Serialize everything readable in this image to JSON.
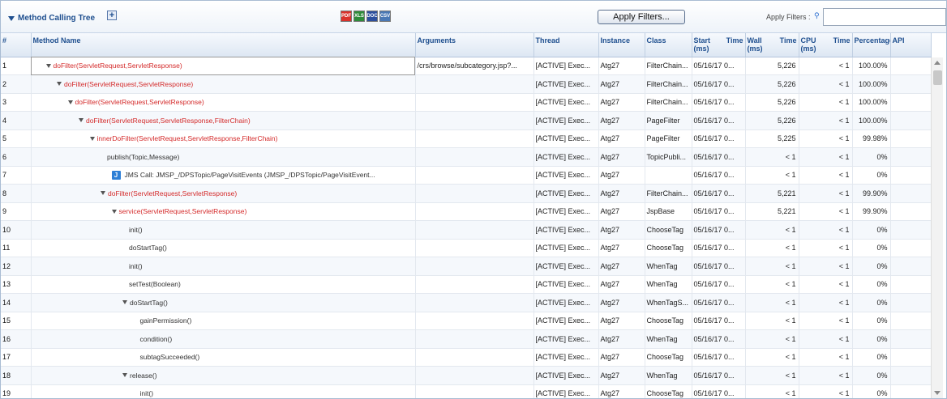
{
  "toolbar": {
    "title": "Method Calling Tree",
    "expand_label": "+",
    "exports": [
      {
        "label": "PDF",
        "icon": "pdf-icon"
      },
      {
        "label": "XLS",
        "icon": "excel-icon"
      },
      {
        "label": "DOC",
        "icon": "word-icon"
      },
      {
        "label": "CSV",
        "icon": "csv-icon"
      }
    ],
    "apply_filters_button": "Apply Filters...",
    "apply_filters_label": "Apply Filters :",
    "search_icon": "search-icon",
    "filter_value": "",
    "filter_placeholder": ""
  },
  "columns": {
    "idx": "#",
    "method": "Method Name",
    "arguments": "Arguments",
    "thread": "Thread",
    "instance": "Instance",
    "class": "Class",
    "start_a": "Start",
    "start_b": "Time",
    "start_unit": "(ms)",
    "wall_a": "Wall",
    "wall_b": "Time",
    "wall_unit": "(ms)",
    "cpu_a": "CPU",
    "cpu_b": "Time",
    "cpu_unit": "(ms)",
    "percentage": "Percentage",
    "api": "API"
  },
  "rows": [
    {
      "idx": "1",
      "depth": 0,
      "expand": true,
      "color": "red",
      "method": "doFilter(ServletRequest,ServletResponse)",
      "arguments": "/crs/browse/subcategory.jsp?...",
      "thread": "[ACTIVE] Exec...",
      "instance": "Atg27",
      "class": "FilterChain...",
      "start": "05/16/17 0...",
      "wall": "5,226",
      "cpu": "< 1",
      "pct": "100.00%",
      "api": ""
    },
    {
      "idx": "2",
      "depth": 1,
      "expand": true,
      "color": "red",
      "method": "doFilter(ServletRequest,ServletResponse)",
      "arguments": "",
      "thread": "[ACTIVE] Exec...",
      "instance": "Atg27",
      "class": "FilterChain...",
      "start": "05/16/17 0...",
      "wall": "5,226",
      "cpu": "< 1",
      "pct": "100.00%",
      "api": ""
    },
    {
      "idx": "3",
      "depth": 2,
      "expand": true,
      "color": "red",
      "method": "doFilter(ServletRequest,ServletResponse)",
      "arguments": "",
      "thread": "[ACTIVE] Exec...",
      "instance": "Atg27",
      "class": "FilterChain...",
      "start": "05/16/17 0...",
      "wall": "5,226",
      "cpu": "< 1",
      "pct": "100.00%",
      "api": ""
    },
    {
      "idx": "4",
      "depth": 3,
      "expand": true,
      "color": "red",
      "method": "doFilter(ServletRequest,ServletResponse,FilterChain)",
      "arguments": "",
      "thread": "[ACTIVE] Exec...",
      "instance": "Atg27",
      "class": "PageFilter",
      "start": "05/16/17 0...",
      "wall": "5,226",
      "cpu": "< 1",
      "pct": "100.00%",
      "api": ""
    },
    {
      "idx": "5",
      "depth": 4,
      "expand": true,
      "color": "red",
      "method": "innerDoFilter(ServletRequest,ServletResponse,FilterChain)",
      "arguments": "",
      "thread": "[ACTIVE] Exec...",
      "instance": "Atg27",
      "class": "PageFilter",
      "start": "05/16/17 0...",
      "wall": "5,225",
      "cpu": "< 1",
      "pct": "99.98%",
      "api": ""
    },
    {
      "idx": "6",
      "depth": 5,
      "expand": false,
      "color": "dark",
      "method": "publish(Topic,Message)",
      "arguments": "",
      "thread": "[ACTIVE] Exec...",
      "instance": "Atg27",
      "class": "TopicPubli...",
      "start": "05/16/17 0...",
      "wall": "< 1",
      "cpu": "< 1",
      "pct": "0%",
      "api": ""
    },
    {
      "idx": "7",
      "depth": 6,
      "expand": false,
      "color": "dark",
      "jms": true,
      "method": "JMS Call: JMSP_/DPSTopic/PageVisitEvents (JMSP_/DPSTopic/PageVisitEvent...",
      "arguments": "",
      "thread": "[ACTIVE] Exec...",
      "instance": "Atg27",
      "class": "",
      "start": "05/16/17 0...",
      "wall": "< 1",
      "cpu": "< 1",
      "pct": "0%",
      "api": ""
    },
    {
      "idx": "8",
      "depth": 5,
      "expand": true,
      "color": "red",
      "method": "doFilter(ServletRequest,ServletResponse)",
      "arguments": "",
      "thread": "[ACTIVE] Exec...",
      "instance": "Atg27",
      "class": "FilterChain...",
      "start": "05/16/17 0...",
      "wall": "5,221",
      "cpu": "< 1",
      "pct": "99.90%",
      "api": ""
    },
    {
      "idx": "9",
      "depth": 6,
      "expand": true,
      "color": "red",
      "method": "service(ServletRequest,ServletResponse)",
      "arguments": "",
      "thread": "[ACTIVE] Exec...",
      "instance": "Atg27",
      "class": "JspBase",
      "start": "05/16/17 0...",
      "wall": "5,221",
      "cpu": "< 1",
      "pct": "99.90%",
      "api": ""
    },
    {
      "idx": "10",
      "depth": 7,
      "expand": false,
      "color": "dark",
      "method": "init()",
      "arguments": "",
      "thread": "[ACTIVE] Exec...",
      "instance": "Atg27",
      "class": "ChooseTag",
      "start": "05/16/17 0...",
      "wall": "< 1",
      "cpu": "< 1",
      "pct": "0%",
      "api": ""
    },
    {
      "idx": "11",
      "depth": 7,
      "expand": false,
      "color": "dark",
      "method": "doStartTag()",
      "arguments": "",
      "thread": "[ACTIVE] Exec...",
      "instance": "Atg27",
      "class": "ChooseTag",
      "start": "05/16/17 0...",
      "wall": "< 1",
      "cpu": "< 1",
      "pct": "0%",
      "api": ""
    },
    {
      "idx": "12",
      "depth": 7,
      "expand": false,
      "color": "dark",
      "method": "init()",
      "arguments": "",
      "thread": "[ACTIVE] Exec...",
      "instance": "Atg27",
      "class": "WhenTag",
      "start": "05/16/17 0...",
      "wall": "< 1",
      "cpu": "< 1",
      "pct": "0%",
      "api": ""
    },
    {
      "idx": "13",
      "depth": 7,
      "expand": false,
      "color": "dark",
      "method": "setTest(Boolean)",
      "arguments": "",
      "thread": "[ACTIVE] Exec...",
      "instance": "Atg27",
      "class": "WhenTag",
      "start": "05/16/17 0...",
      "wall": "< 1",
      "cpu": "< 1",
      "pct": "0%",
      "api": ""
    },
    {
      "idx": "14",
      "depth": 7,
      "expand": true,
      "color": "dark",
      "method": "doStartTag()",
      "arguments": "",
      "thread": "[ACTIVE] Exec...",
      "instance": "Atg27",
      "class": "WhenTagS...",
      "start": "05/16/17 0...",
      "wall": "< 1",
      "cpu": "< 1",
      "pct": "0%",
      "api": ""
    },
    {
      "idx": "15",
      "depth": 8,
      "expand": false,
      "color": "dark",
      "method": "gainPermission()",
      "arguments": "",
      "thread": "[ACTIVE] Exec...",
      "instance": "Atg27",
      "class": "ChooseTag",
      "start": "05/16/17 0...",
      "wall": "< 1",
      "cpu": "< 1",
      "pct": "0%",
      "api": ""
    },
    {
      "idx": "16",
      "depth": 8,
      "expand": false,
      "color": "dark",
      "method": "condition()",
      "arguments": "",
      "thread": "[ACTIVE] Exec...",
      "instance": "Atg27",
      "class": "WhenTag",
      "start": "05/16/17 0...",
      "wall": "< 1",
      "cpu": "< 1",
      "pct": "0%",
      "api": ""
    },
    {
      "idx": "17",
      "depth": 8,
      "expand": false,
      "color": "dark",
      "method": "subtagSucceeded()",
      "arguments": "",
      "thread": "[ACTIVE] Exec...",
      "instance": "Atg27",
      "class": "ChooseTag",
      "start": "05/16/17 0...",
      "wall": "< 1",
      "cpu": "< 1",
      "pct": "0%",
      "api": ""
    },
    {
      "idx": "18",
      "depth": 7,
      "expand": true,
      "color": "dark",
      "method": "release()",
      "arguments": "",
      "thread": "[ACTIVE] Exec...",
      "instance": "Atg27",
      "class": "WhenTag",
      "start": "05/16/17 0...",
      "wall": "< 1",
      "cpu": "< 1",
      "pct": "0%",
      "api": ""
    },
    {
      "idx": "19",
      "depth": 8,
      "expand": false,
      "color": "dark",
      "method": "init()",
      "arguments": "",
      "thread": "[ACTIVE] Exec...",
      "instance": "Atg27",
      "class": "ChooseTag",
      "start": "05/16/17 0...",
      "wall": "< 1",
      "cpu": "< 1",
      "pct": "0%",
      "api": ""
    }
  ]
}
